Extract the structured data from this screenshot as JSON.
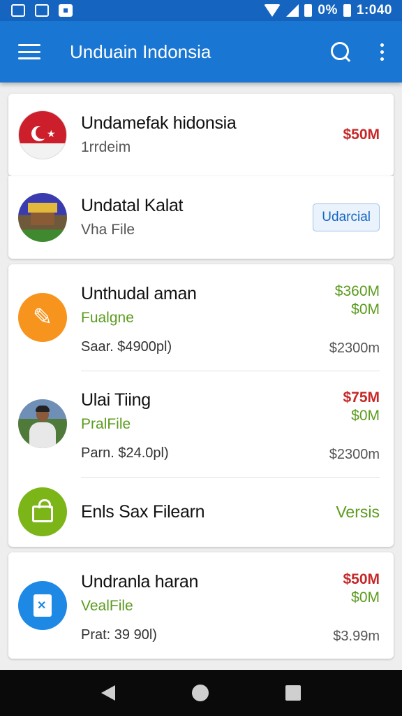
{
  "status": {
    "battery": "0%",
    "time": "1:040"
  },
  "header": {
    "title": "Unduain Indonsia"
  },
  "items": [
    {
      "title": "Undamefak hidonsia",
      "subtitle": "1rrdeim",
      "price": "$50M",
      "icon": "turkey-flag-avatar"
    },
    {
      "title": "Undatal Kalat",
      "subtitle": "Vha File",
      "button": "Udarcial",
      "icon": "house-avatar"
    },
    {
      "title": "Unthudal aman",
      "subtitle": "Fualgne",
      "detail": "Saar. $4900pl)",
      "price_top": "$360M",
      "price_green": "$0M",
      "size": "$2300m",
      "icon": "tools-avatar"
    },
    {
      "title": "Ulai Tiing",
      "subtitle": "PralFile",
      "detail": "Parn. $24.0pl)",
      "price_top": "$75M",
      "price_green": "$0M",
      "size": "$2300m",
      "icon": "person-photo-avatar"
    },
    {
      "title": "Enls Sax Filearn",
      "version": "Versis",
      "icon": "bag-avatar"
    },
    {
      "title": "Undranla haran",
      "subtitle": "VealFile",
      "detail": "Prat: 39 90l)",
      "price_top": "$50M",
      "price_green": "$0M",
      "size": "$3.99m",
      "icon": "document-avatar"
    }
  ],
  "colors": {
    "primary": "#1976d2",
    "status": "#1565c0",
    "red": "#c62828",
    "green": "#5b9b1e"
  }
}
